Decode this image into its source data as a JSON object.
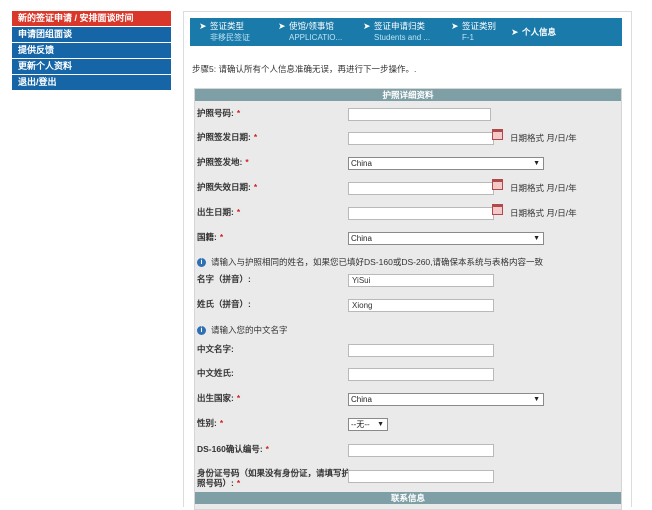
{
  "sidebar": {
    "items": [
      {
        "label": "新的签证申请 / 安排面谈时间"
      },
      {
        "label": "申请团组面谈"
      },
      {
        "label": "提供反馈"
      },
      {
        "label": "更新个人资料"
      },
      {
        "label": "退出/登出"
      }
    ]
  },
  "steps": [
    {
      "title": "签证类型",
      "sub": "非移民签证"
    },
    {
      "title": "使馆/领事馆",
      "sub": "APPLICATIO..."
    },
    {
      "title": "签证申请归类",
      "sub": "Students and ..."
    },
    {
      "title": "签证类别",
      "sub": "F-1"
    },
    {
      "title": "个人信息",
      "sub": ""
    }
  ],
  "instruction": "步骤5: 请确认所有个人信息准确无误，再进行下一步操作。.",
  "form": {
    "header": "护照详细资料",
    "fields": {
      "passport_no": {
        "label": "护照号码:",
        "value": ""
      },
      "issue_date": {
        "label": "护照签发日期:",
        "value": "",
        "hint": "日期格式 月/日/年"
      },
      "issue_place": {
        "label": "护照签发地:",
        "value": "China"
      },
      "expiry_date": {
        "label": "护照失效日期:",
        "value": "",
        "hint": "日期格式 月/日/年"
      },
      "birth_date": {
        "label": "出生日期:",
        "value": "",
        "hint": "日期格式 月/日/年"
      },
      "nationality": {
        "label": "国籍:",
        "value": "China"
      },
      "given_name": {
        "label": "名字（拼音）:",
        "value": "YiSui"
      },
      "surname": {
        "label": "姓氏（拼音）:",
        "value": "Xiong"
      },
      "cn_given_name": {
        "label": "中文名字:",
        "value": ""
      },
      "cn_surname": {
        "label": "中文姓氏:",
        "value": ""
      },
      "birth_country": {
        "label": "出生国家:",
        "value": "China"
      },
      "gender": {
        "label": "性别:",
        "value": "--无--"
      },
      "ds160": {
        "label": "DS-160确认编号:",
        "value": ""
      },
      "id_number": {
        "label_line1": "身份证号码（如果没有身份证，请填写护",
        "label_line2": "照号码）:",
        "value": ""
      }
    },
    "note_pinyin": "请输入与护照相同的姓名，如果您已填好DS-160或DS-260,请确保本系统与表格内容一致",
    "note_chinese": "请输入您的中文名字",
    "contact_header": "联系信息",
    "required_mark": "*"
  },
  "colors": {
    "active_sidebar": "#d9372a",
    "sidebar": "#1565a7",
    "stepbar": "#1a7aaa",
    "section_header": "#7f9fa6"
  }
}
